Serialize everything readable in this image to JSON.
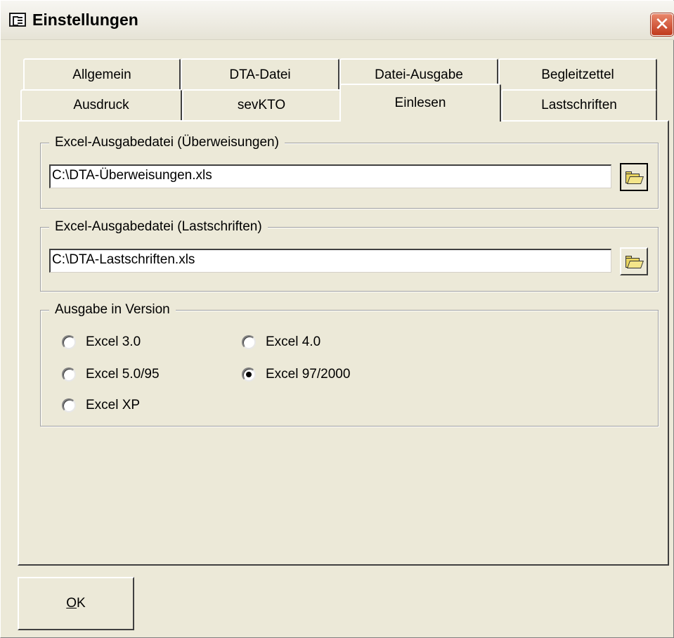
{
  "window": {
    "title": "Einstellungen",
    "close_label": "✕"
  },
  "tabs": {
    "row1": [
      "Allgemein",
      "DTA-Datei",
      "Datei-Ausgabe",
      "Begleitzettel"
    ],
    "row2": [
      "Ausdruck",
      "sevKTO",
      "Einlesen",
      "Lastschriften"
    ],
    "active": "Einlesen"
  },
  "group_ueberweisungen": {
    "legend": "Excel-Ausgabedatei (Überweisungen)",
    "path": "C:\\DTA-Überweisungen.xls"
  },
  "group_lastschriften": {
    "legend": "Excel-Ausgabedatei (Lastschriften)",
    "path": "C:\\DTA-Lastschriften.xls"
  },
  "group_version": {
    "legend": "Ausgabe in Version",
    "options": [
      {
        "label": "Excel 3.0",
        "checked": false
      },
      {
        "label": "Excel 4.0",
        "checked": false
      },
      {
        "label": "Excel 5.0/95",
        "checked": false
      },
      {
        "label": "Excel 97/2000",
        "checked": true
      },
      {
        "label": "Excel XP",
        "checked": false
      }
    ]
  },
  "ok_button": {
    "label_first": "O",
    "label_rest": "K"
  },
  "icons": {
    "app": "form-icon",
    "close": "close-icon",
    "browse": "folder-open-icon"
  }
}
